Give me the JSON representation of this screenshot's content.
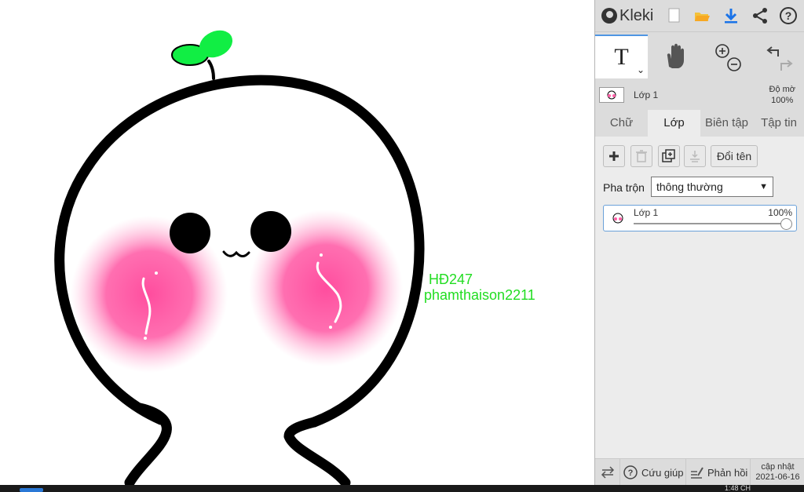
{
  "canvas": {
    "overlay_line1": "HĐ247",
    "overlay_line2": "phamthaison2211",
    "text_color": "#22dd22",
    "sprout_color": "#11ee44",
    "blush_color": "#ff5fa6"
  },
  "app": {
    "name": "Kleki",
    "top_icons": [
      "new-page-icon",
      "open-folder-icon",
      "download-icon",
      "share-icon",
      "help-icon"
    ]
  },
  "tools": {
    "text_tool_glyph": "T",
    "tool_icons": [
      "text-tool-icon",
      "hand-tool-icon",
      "zoom-in-icon",
      "zoom-out-icon",
      "undo-icon",
      "redo-icon"
    ]
  },
  "layer_header": {
    "layer_name": "Lớp 1",
    "opacity_label": "Độ mờ",
    "opacity_value": "100%"
  },
  "tabs": [
    {
      "label": "Chữ"
    },
    {
      "label": "Lớp"
    },
    {
      "label": "Biên tập"
    },
    {
      "label": "Tập tin"
    }
  ],
  "active_tab": "Lớp",
  "layers_panel": {
    "rename_label": "Đổi tên",
    "blend_label": "Pha trộn",
    "blend_value": "thông thường",
    "layers": [
      {
        "name": "Lớp 1",
        "opacity": "100%"
      }
    ]
  },
  "bottom_bar": {
    "help_label": "Cứu giúp",
    "feedback_label": "Phản hồi",
    "update_label": "cập nhật",
    "update_date": "2021-06-16"
  },
  "taskbar": {
    "clock": "1:48 CH"
  }
}
